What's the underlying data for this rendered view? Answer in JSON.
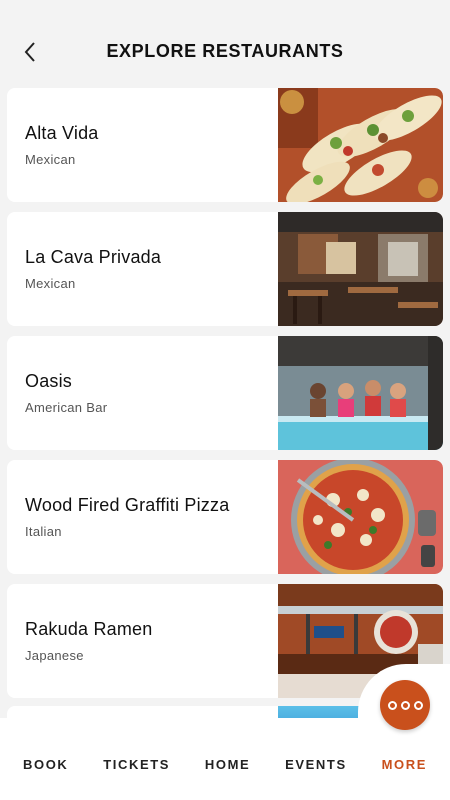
{
  "header": {
    "title": "EXPLORE RESTAURANTS",
    "back_icon": "chevron-left-icon"
  },
  "restaurants": [
    {
      "name": "Alta Vida",
      "cuisine": "Mexican"
    },
    {
      "name": "La Cava Privada",
      "cuisine": "Mexican"
    },
    {
      "name": "Oasis",
      "cuisine": "American Bar"
    },
    {
      "name": "Wood Fired Graffiti Pizza",
      "cuisine": "Italian"
    },
    {
      "name": "Rakuda Ramen",
      "cuisine": "Japanese"
    }
  ],
  "nav": {
    "items": [
      {
        "label": "BOOK"
      },
      {
        "label": "TICKETS"
      },
      {
        "label": "HOME"
      },
      {
        "label": "EVENTS"
      },
      {
        "label": "MORE"
      }
    ],
    "active": "MORE",
    "more_icon": "more-dots-icon"
  },
  "colors": {
    "accent": "#c9501c",
    "background": "#f3f3f3",
    "card": "#ffffff"
  }
}
